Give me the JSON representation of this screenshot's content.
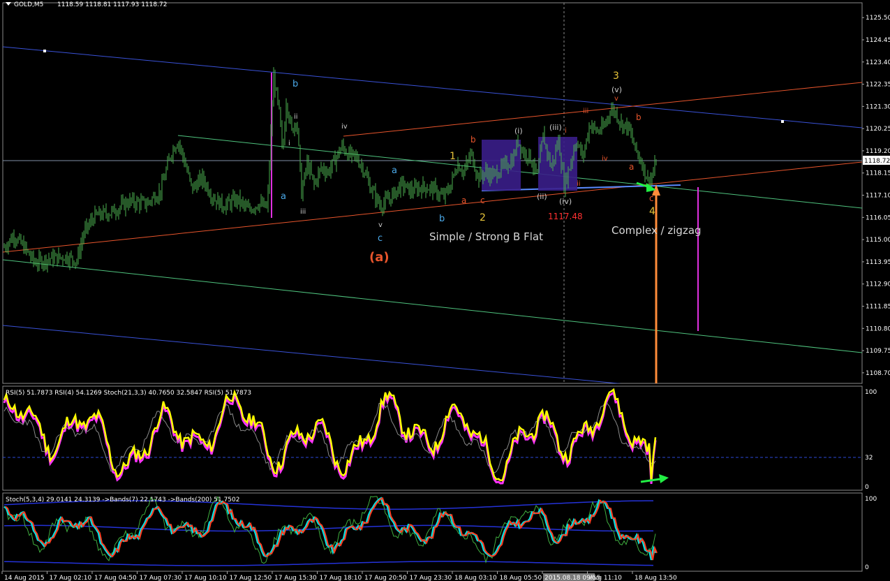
{
  "window": {
    "symbol_label": "GOLD,M5",
    "ohlc_label": "1118.59 1118.81 1117.93 1118.72"
  },
  "colors": {
    "background": "#000000",
    "candles": "#4caf50",
    "grid_line": "#9a9a9a",
    "price_line": "#7f8fa6",
    "channel_blue": "#3a52d8",
    "channel_orange": "#e8552c",
    "channel_green": "#4fc37e",
    "rsi_main": "#ffff00",
    "rsi_secondary": "#ff33ff",
    "stoch_signal": "#ff3b1f",
    "stoch_main": "#00e0e0",
    "bands": "#2432d8",
    "box_fill": "#3a1e8a",
    "arrow_orange": "#ff8c3a",
    "arrow_green": "#22ee44",
    "magenta_line": "#e030e0"
  },
  "main_panel": {
    "price_axis": [
      "1125.50",
      "1124.45",
      "1123.40",
      "1122.35",
      "1121.30",
      "1120.25",
      "1119.20",
      "1118.15",
      "1117.10",
      "1116.05",
      "1115.00",
      "1113.95",
      "1112.90",
      "1111.85",
      "1110.80",
      "1109.75",
      "1108.70"
    ],
    "current_price": "1118.72",
    "price_marker": "1117.48",
    "annotations": {
      "wave_b_top": "b",
      "wave_a_left": "a",
      "wave_i_left": "i",
      "wave_ii_left": "ii",
      "wave_iii_left": "iii",
      "wave_iv_top": "iv",
      "wave_v_low": "v",
      "wave_c_low": "c",
      "wave_a_mid": "a",
      "wave_b_low": "b",
      "wave_1": "1",
      "wave_2": "2",
      "wave_b_flat": "b",
      "wave_a_flat": "a",
      "wave_c_flat": "c",
      "wave_i_paren": "(i)",
      "wave_ii_paren": "(ii)",
      "wave_iii_paren": "(iii)",
      "wave_iv_paren": "(iv)",
      "wave_i_small": "i",
      "wave_ii_small": "ii",
      "wave_iii_small": "iii",
      "wave_iv_small": "iv",
      "wave_3": "3",
      "wave_v_paren": "(v)",
      "wave_v_small": "v",
      "wave_b_right": "b",
      "wave_a_right": "a",
      "wave_c_right": "c",
      "wave_4": "4",
      "wave_a_paren": "(a)",
      "flat_caption": "Simple / Strong B Flat",
      "zigzag_caption": "Complex / zigzag"
    }
  },
  "rsi_panel": {
    "header": "RSI(5) 51.7873  RSI(4) 54.1269  Stoch(21,3,3) 40.7650 32.5847  RSI(5) 51.7873",
    "axis": [
      "100",
      "32",
      "0"
    ]
  },
  "stoch_panel": {
    "header": "Stoch(5,3,4) 29.0141 24.3139  ->Bands(7) 22.1743  ->Bands(200) 51.7502",
    "axis": [
      "100",
      "0"
    ]
  },
  "time_axis": [
    "14 Aug 2015",
    "17 Aug 02:10",
    "17 Aug 04:50",
    "17 Aug 07:30",
    "17 Aug 10:10",
    "17 Aug 12:50",
    "17 Aug 15:30",
    "17 Aug 18:10",
    "17 Aug 20:50",
    "17 Aug 23:30",
    "18 Aug 03:10",
    "18 Aug 05:50",
    "2015.08.18 09:55",
    "Aug 11:10",
    "18 Aug 13:50"
  ],
  "chart_data": {
    "type": "line",
    "title": "GOLD,M5",
    "ylim": [
      1108.2,
      1126.2
    ],
    "price_path": [
      [
        0,
        1114.4
      ],
      [
        20,
        1115.2
      ],
      [
        35,
        1114.6
      ],
      [
        50,
        1113.9
      ],
      [
        70,
        1114.1
      ],
      [
        95,
        1114.2
      ],
      [
        110,
        1114.0
      ],
      [
        120,
        1115.3
      ],
      [
        135,
        1116.1
      ],
      [
        160,
        1116.3
      ],
      [
        185,
        1116.8
      ],
      [
        210,
        1116.7
      ],
      [
        230,
        1117.3
      ],
      [
        245,
        1119.1
      ],
      [
        255,
        1119.7
      ],
      [
        265,
        1118.6
      ],
      [
        275,
        1117.4
      ],
      [
        290,
        1117.9
      ],
      [
        305,
        1117.0
      ],
      [
        320,
        1116.6
      ],
      [
        340,
        1116.9
      ],
      [
        355,
        1116.4
      ],
      [
        370,
        1116.7
      ],
      [
        383,
        1116.5
      ],
      [
        388,
        1120.0
      ],
      [
        392,
        1122.7
      ],
      [
        400,
        1121.0
      ],
      [
        405,
        1119.0
      ],
      [
        410,
        1121.6
      ],
      [
        418,
        1120.1
      ],
      [
        425,
        1120.8
      ],
      [
        432,
        1117.2
      ],
      [
        440,
        1118.6
      ],
      [
        450,
        1117.6
      ],
      [
        460,
        1118.4
      ],
      [
        470,
        1118.2
      ],
      [
        480,
        1118.8
      ],
      [
        490,
        1119.4
      ],
      [
        500,
        1119.0
      ],
      [
        510,
        1118.9
      ],
      [
        520,
        1118.4
      ],
      [
        530,
        1117.5
      ],
      [
        545,
        1116.6
      ],
      [
        560,
        1117.0
      ],
      [
        575,
        1117.6
      ],
      [
        590,
        1117.3
      ],
      [
        605,
        1117.5
      ],
      [
        620,
        1117.4
      ],
      [
        635,
        1117.0
      ],
      [
        645,
        1117.5
      ],
      [
        655,
        1118.6
      ],
      [
        665,
        1118.2
      ],
      [
        675,
        1119.1
      ],
      [
        685,
        1117.9
      ],
      [
        695,
        1118.2
      ],
      [
        705,
        1118.0
      ],
      [
        720,
        1118.4
      ],
      [
        735,
        1118.8
      ],
      [
        742,
        1119.7
      ],
      [
        750,
        1119.1
      ],
      [
        758,
        1119.0
      ],
      [
        770,
        1118.0
      ],
      [
        778,
        1119.9
      ],
      [
        790,
        1118.4
      ],
      [
        800,
        1119.7
      ],
      [
        808,
        1117.6
      ],
      [
        815,
        1118.3
      ],
      [
        825,
        1119.7
      ],
      [
        835,
        1118.9
      ],
      [
        845,
        1120.5
      ],
      [
        855,
        1120.1
      ],
      [
        865,
        1120.3
      ],
      [
        875,
        1121.2
      ],
      [
        882,
        1121.0
      ],
      [
        890,
        1120.5
      ],
      [
        900,
        1120.3
      ],
      [
        910,
        1119.3
      ],
      [
        920,
        1118.6
      ],
      [
        928,
        1117.8
      ],
      [
        935,
        1118.0
      ],
      [
        940,
        1118.7
      ]
    ]
  }
}
